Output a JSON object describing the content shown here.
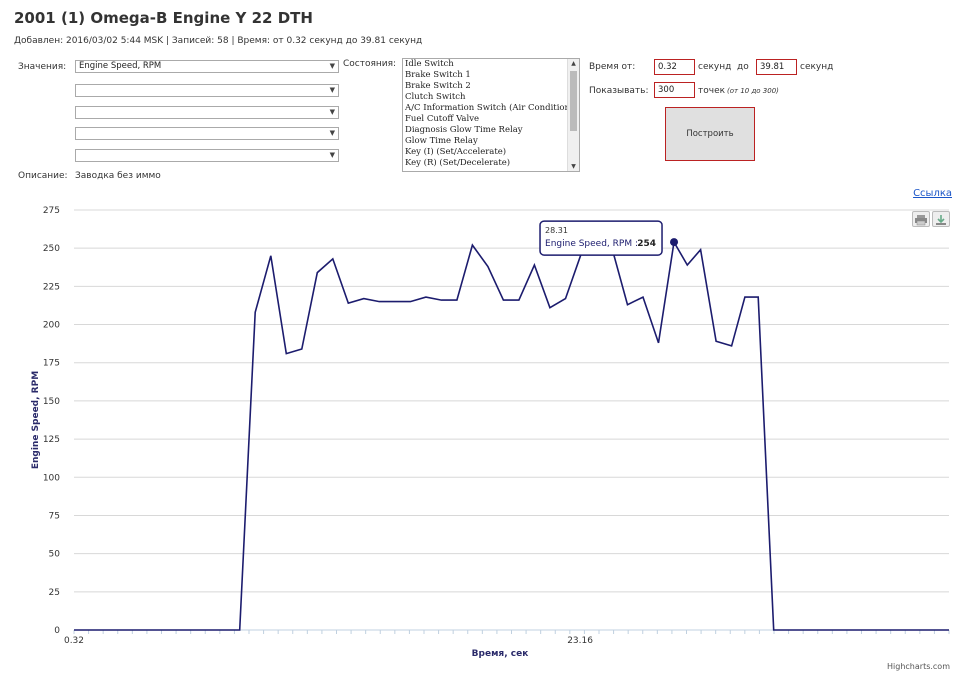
{
  "page": {
    "title": "2001 (1) Omega-B Engine Y 22 DTH",
    "meta": "Добавлен: 2016/03/02 5:44 MSK | Записей: 58 | Время: от 0.32 секунд до 39.81 секунд",
    "values_label": "Значения:",
    "value_selects": [
      "Engine Speed, RPM",
      "",
      "",
      "",
      ""
    ],
    "states_label": "Состояния:",
    "states": [
      "Idle Switch",
      "Brake Switch 1",
      "Brake Switch 2",
      "Clutch Switch",
      "A/C Information Switch (Air Conditioning)",
      "Fuel Cutoff Valve",
      "Diagnosis Glow Time Relay",
      "Glow Time Relay",
      "Key (I) (Set/Accelerate)",
      "Key (R) (Set/Decelerate)"
    ],
    "time_from_label": "Время от:",
    "time_from": "0.32",
    "seconds_label": "секунд",
    "to_label": "до",
    "time_to": "39.81",
    "seconds_label2": "секунд",
    "show_label": "Показывать:",
    "points": "300",
    "points_label": "точек",
    "points_hint": "(от 10 до 300)",
    "build_button": "Построить",
    "description_label": "Описание:",
    "description": "Заводка без иммо",
    "link": "Ссылка",
    "credits": "Highcharts.com",
    "icons": [
      "printer-icon",
      "download-icon"
    ]
  },
  "chart_data": {
    "type": "line",
    "xlabel": "Время, сек",
    "ylabel": "Engine Speed, RPM",
    "ylim": [
      0,
      275
    ],
    "yticks": [
      0,
      25,
      50,
      75,
      100,
      125,
      150,
      175,
      200,
      225,
      250,
      275
    ],
    "xlim": [
      0.32,
      39.81
    ],
    "xtick_labels": [
      {
        "x": 0.32,
        "label": "0.32"
      },
      {
        "x": 23.16,
        "label": "23.16"
      }
    ],
    "grid": true,
    "color": "#1c1c6e",
    "series": [
      {
        "name": "Engine Speed, RPM",
        "x": [
          0.32,
          7.8,
          8.5,
          9.2,
          9.9,
          10.6,
          11.3,
          12.0,
          12.7,
          13.4,
          14.1,
          14.8,
          15.5,
          16.2,
          16.9,
          17.6,
          18.3,
          19.0,
          19.7,
          20.4,
          21.1,
          21.8,
          22.5,
          23.2,
          23.9,
          24.6,
          25.3,
          26.0,
          26.7,
          27.4,
          28.0,
          28.6,
          29.3,
          30.0,
          30.6,
          31.2,
          31.9,
          32.6,
          33.3,
          34.0,
          34.3,
          39.81
        ],
        "y": [
          0,
          0,
          208,
          245,
          181,
          184,
          234,
          243,
          214,
          217,
          215,
          215,
          215,
          218,
          216,
          216,
          252,
          238,
          216,
          216,
          239,
          211,
          217,
          246,
          253,
          250,
          213,
          218,
          188,
          254,
          239,
          249,
          189,
          186,
          218,
          218,
          0,
          0,
          0,
          0,
          0,
          0
        ]
      }
    ],
    "tooltip": {
      "x_label": "28.31",
      "series": "Engine Speed, RPM",
      "value": "254"
    }
  }
}
